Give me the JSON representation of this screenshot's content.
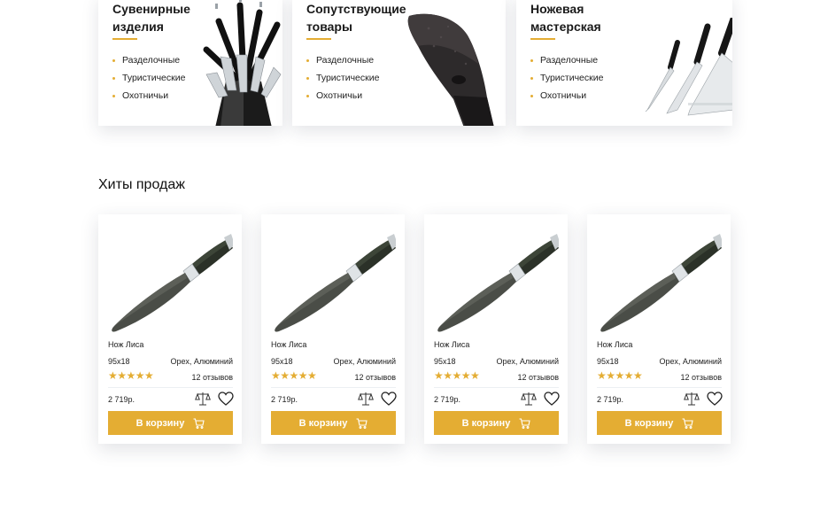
{
  "categories": [
    {
      "title": "Сувенирные изделия",
      "items": [
        "Разделочные",
        "Туристические",
        "Охотничьи"
      ],
      "image_icon": "knife-block-set-icon"
    },
    {
      "title": "Сопутствующие товары",
      "items": [
        "Разделочные",
        "Туристические",
        "Охотничьи"
      ],
      "image_icon": "knife-sheath-icon"
    },
    {
      "title": "Ножевая мастерская",
      "items": [
        "Разделочные",
        "Туристические",
        "Охотничьи"
      ],
      "image_icon": "kitchen-knives-icon"
    }
  ],
  "bestsellers": {
    "title": "Хиты продаж",
    "products": [
      {
        "name": "Нож Лиса",
        "size": "95x18",
        "material": "Орех, Алюминий",
        "rating": 5,
        "stars": "★★★★★",
        "reviews": "12 отзывов",
        "price": "2 719р.",
        "cart_label": "В корзину"
      },
      {
        "name": "Нож Лиса",
        "size": "95x18",
        "material": "Орех, Алюминий",
        "rating": 5,
        "stars": "★★★★★",
        "reviews": "12 отзывов",
        "price": "2 719р.",
        "cart_label": "В корзину"
      },
      {
        "name": "Нож Лиса",
        "size": "95x18",
        "material": "Орех, Алюминий",
        "rating": 5,
        "stars": "★★★★★",
        "reviews": "12 отзывов",
        "price": "2 719р.",
        "cart_label": "В корзину"
      },
      {
        "name": "Нож Лиса",
        "size": "95x18",
        "material": "Орех, Алюминий",
        "rating": 5,
        "stars": "★★★★★",
        "reviews": "12 отзывов",
        "price": "2 719р.",
        "cart_label": "В корзину"
      }
    ]
  },
  "colors": {
    "accent": "#e4ad33",
    "text": "#1a1a1a"
  }
}
